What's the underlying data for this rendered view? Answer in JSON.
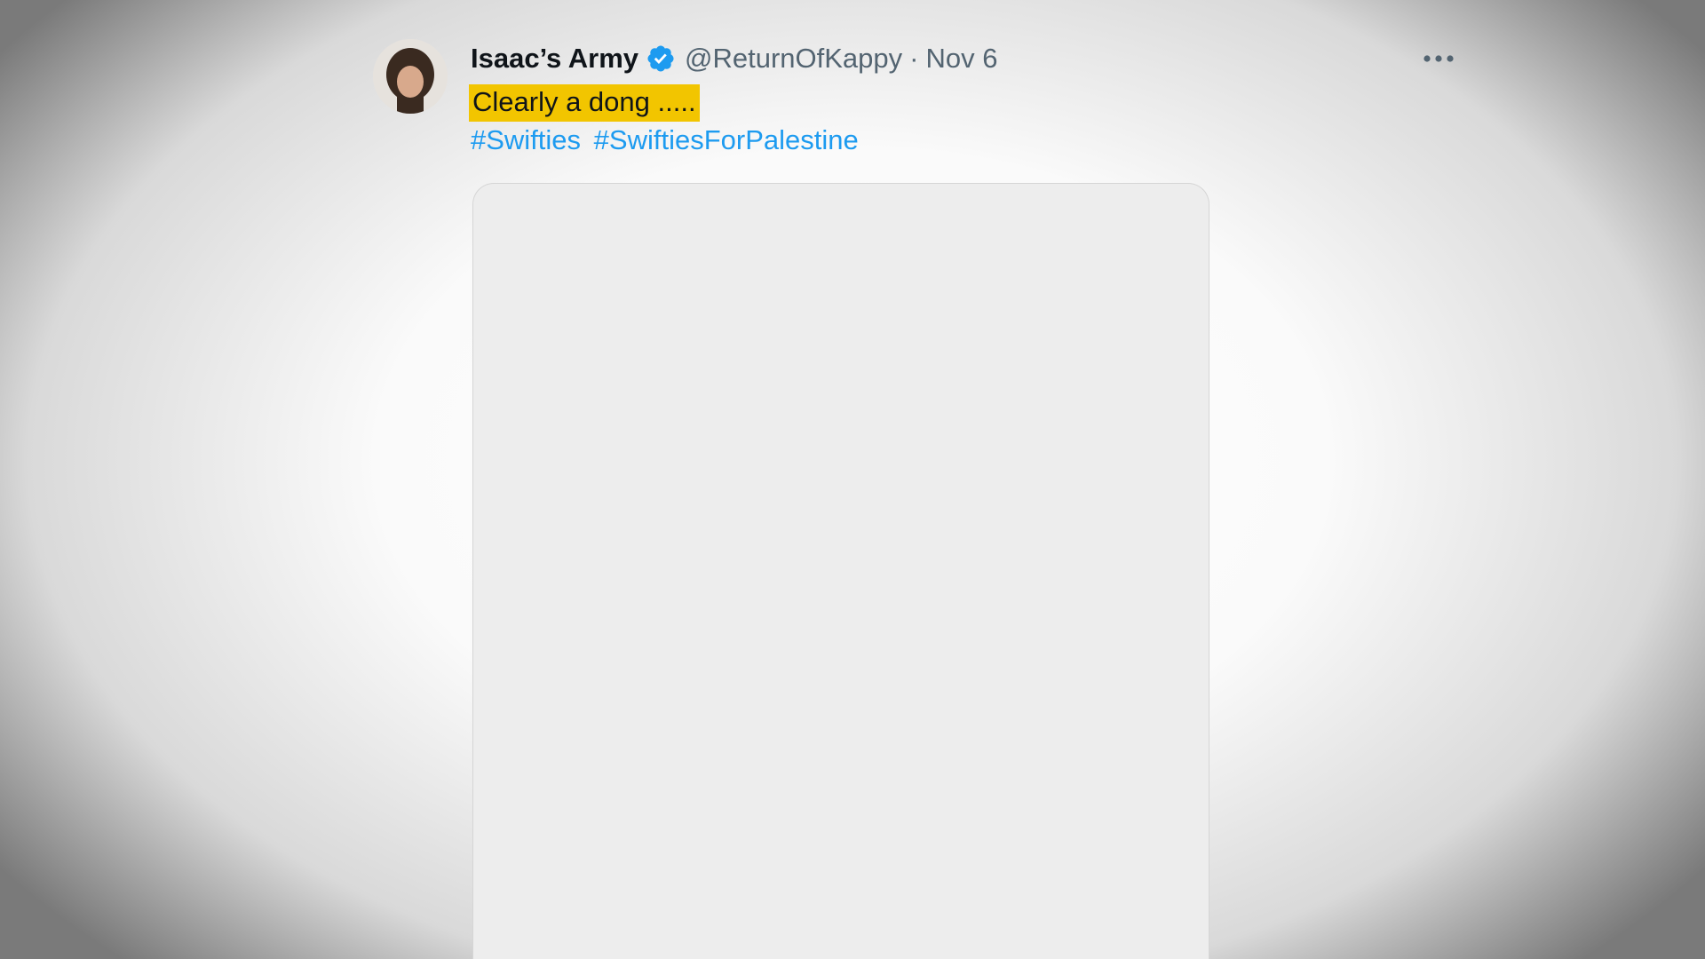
{
  "tweet": {
    "author": {
      "display_name": "Isaac’s Army",
      "verified": true,
      "handle": "@ReturnOfKappy",
      "avatar_icon": "person-avatar-icon"
    },
    "separator": "·",
    "date": "Nov 6",
    "caption": "Clearly a dong .....",
    "caption_highlight_color": "#f2c500",
    "hashtags": [
      "#Swifties",
      "#SwiftiesForPalestine"
    ],
    "hashtag_color": "#1d9bf0",
    "verified_color": "#1d9bf0",
    "more_icon": "more-horizontal-icon"
  }
}
